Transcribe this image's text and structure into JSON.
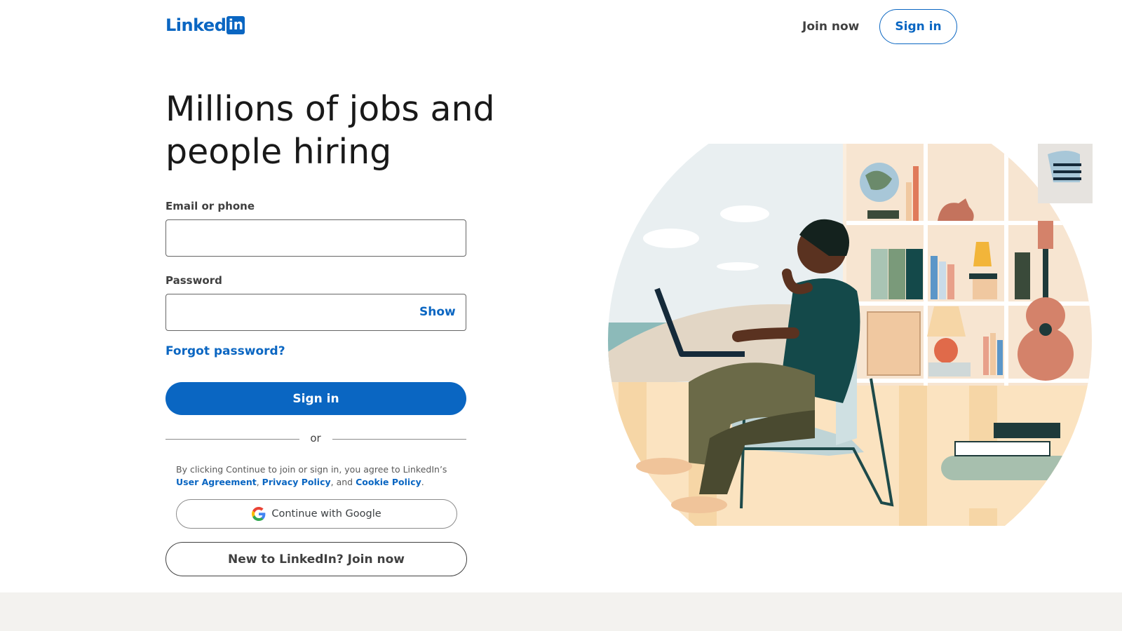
{
  "header": {
    "logo_text": "Linked",
    "logo_box": "in",
    "join_now": "Join now",
    "sign_in": "Sign in"
  },
  "main": {
    "headline": "Millions of jobs and people hiring",
    "email_label": "Email or phone",
    "email_value": "",
    "password_label": "Password",
    "password_value": "",
    "show_label": "Show",
    "forgot_password": "Forgot password?",
    "sign_in_button": "Sign in",
    "or_text": "or",
    "legal_prefix": "By clicking Continue to join or sign in, you agree to LinkedIn’s",
    "user_agreement": "User Agreement",
    "privacy_policy": "Privacy Policy",
    "and_text": ", and",
    "cookie_policy": "Cookie Policy",
    "continue_google": "Continue with Google",
    "join_now_button": "New to LinkedIn? Join now"
  },
  "colors": {
    "brand": "#0a66c2",
    "footer": "#f3f2ef"
  },
  "icons": {
    "google": "google-icon"
  }
}
